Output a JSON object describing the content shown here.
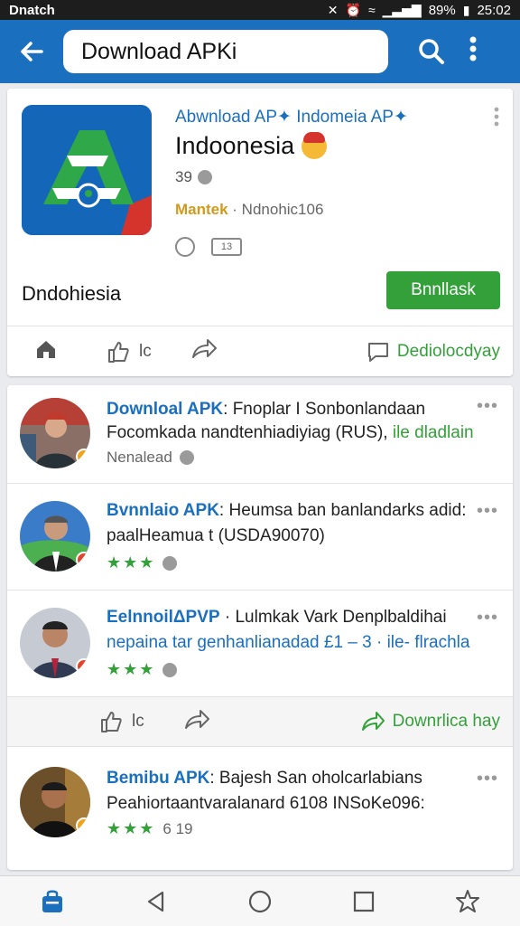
{
  "status_bar": {
    "carrier": "Dnatch",
    "battery": "89%",
    "time": "25:02"
  },
  "app_bar": {
    "search_value": "Download APKi"
  },
  "app_card": {
    "developer": "Abwnload AP✦ Indomeia AP✦",
    "title": "Indoonesia",
    "rating": "39",
    "meta_tag": "Mantek",
    "meta_text": " · Ndnohic106",
    "badge_text": "13",
    "app_name": "Dndohiesia",
    "install_label": "Bnnllask",
    "like_label": "lc",
    "download_label": "Dediolocdyay"
  },
  "posts": [
    {
      "source": "Downloal APK",
      "headline": ": Fnoplar I Sonbonlandaan",
      "line2": "Focomkada nandtenhiadiyiag (RUS),",
      "line2_green": " ile dladlain",
      "footer": "Nenalead",
      "stars": "",
      "count": ""
    },
    {
      "source": "Bvnnlaio APK",
      "headline": ": Heumsa ban banlandarks adid:",
      "line2": "paalHeamua t (USDA90070)",
      "line2_green": "",
      "footer": "",
      "stars": "★★★",
      "count": ""
    },
    {
      "source": "EelnnoilΔPVP",
      "headline": " · Lulmkak Vark Denplbaldihai",
      "line2": "nepaina tar genhanlianadad £1 – 3",
      "line2_green": " · ile- flrachla",
      "footer": "",
      "stars": "★★★",
      "count": ""
    },
    {
      "source": "Bemibu APK",
      "headline": ": Bajesh San oholcarlabians",
      "line2": "Peahiortaantvaralanard 6108 INSoKe096:",
      "line2_green": "",
      "footer": "",
      "stars": "★★★",
      "count": "6  19"
    }
  ],
  "feed_actions": {
    "like_label": "lc",
    "download_label": "Downrlica hay"
  },
  "colors": {
    "appbar": "#1b6fbf",
    "accent_green": "#34a03a",
    "link_blue": "#1b6fbf"
  }
}
